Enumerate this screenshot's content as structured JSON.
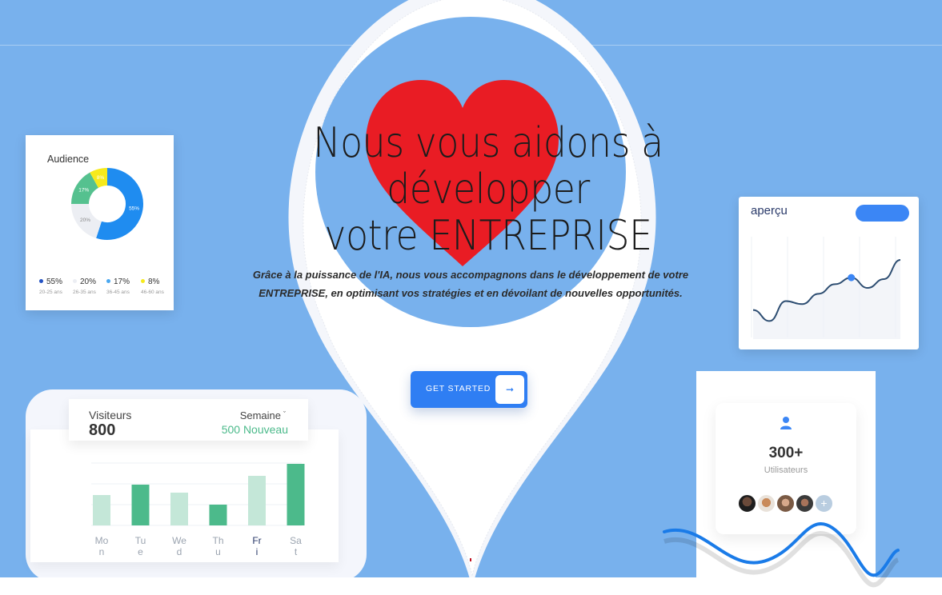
{
  "hero": {
    "title_line1": "Nous vous aidons à développer",
    "title_line2": "votre ENTREPRISE",
    "subtitle_line1": "Grâce à la puissance de l'IA, nous vous accompagnons dans le développement de votre",
    "subtitle_line2": "ENTREPRISE, en optimisant vos stratégies et en dévoilant de nouvelles opportunités.",
    "cta_label": "GET STARTED",
    "cta_icon": "arrow-right-icon"
  },
  "audience": {
    "title": "Audience",
    "segments": [
      {
        "pct": "55%",
        "age": "20-25 ans",
        "color": "#1f8cf0",
        "value": 55
      },
      {
        "pct": "20%",
        "age": "26-35 ans",
        "color": "#eceef3",
        "value": 20
      },
      {
        "pct": "17%",
        "age": "36-45 ans",
        "color": "#55c18f",
        "value": 17
      },
      {
        "pct": "8%",
        "age": "46-60 ans",
        "color": "#f6ea1c",
        "value": 8
      }
    ]
  },
  "apercu": {
    "title": "aperçu",
    "line_values": [
      0.2,
      0.05,
      0.32,
      0.28,
      0.42,
      0.55,
      0.64,
      0.5,
      0.62,
      0.88
    ]
  },
  "visitors": {
    "label": "Visiteurs",
    "count": "800",
    "period": "Semaine",
    "period_icon": "chevron-down-icon",
    "new": "500 Nouveau",
    "bars": [
      {
        "d1": "Mo",
        "d2": "n",
        "value": 38,
        "active": false
      },
      {
        "d1": "Tu",
        "d2": "e",
        "value": 51,
        "active": true
      },
      {
        "d1": "We",
        "d2": "d",
        "value": 41,
        "active": false
      },
      {
        "d1": "Th",
        "d2": "u",
        "value": 26,
        "active": true
      },
      {
        "d1": "Fr",
        "d2": "i",
        "value": 62,
        "active": false
      },
      {
        "d1": "Sa",
        "d2": "t",
        "value": 77,
        "active": true
      }
    ]
  },
  "users": {
    "count": "300+",
    "label": "Utilisateurs",
    "icon": "user-icon"
  },
  "colors": {
    "background": "#78b1ed",
    "accent": "#2f7ef3",
    "green": "#4cba8b",
    "heart": "#e91c24"
  }
}
